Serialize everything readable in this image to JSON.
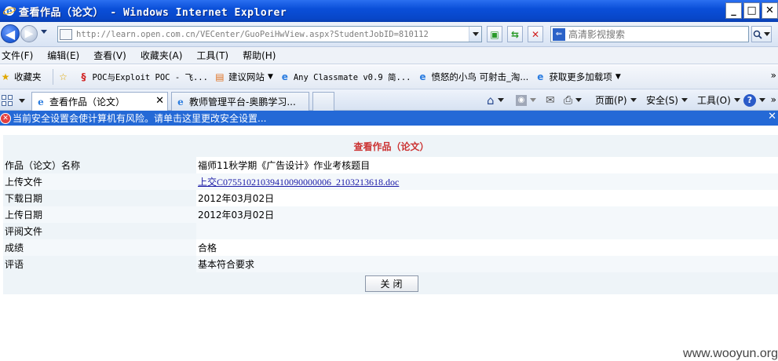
{
  "window": {
    "title": "查看作品（论文） - Windows Internet Explorer",
    "controls": {
      "minimize": "_",
      "maximize": "□",
      "close": "✕"
    }
  },
  "address": {
    "url": "http://learn.open.com.cn/VECenter/GuoPeiHwView.aspx?StudentJobID=810112",
    "search_placeholder": "高清影视搜索"
  },
  "menu": [
    "文件(F)",
    "编辑(E)",
    "查看(V)",
    "收藏夹(A)",
    "工具(T)",
    "帮助(H)"
  ],
  "favorites": {
    "label": "收藏夹",
    "items": [
      "POC与Exploit POC - 飞...",
      "建议网站",
      "Any Classmate v0.9 简...",
      "愤怒的小鸟 可射击_淘...",
      "获取更多加载项"
    ]
  },
  "tabs": [
    {
      "label": "查看作品（论文）",
      "active": true
    },
    {
      "label": "教师管理平台-奥鹏学习...",
      "active": false
    }
  ],
  "commands": {
    "page": "页面(P)",
    "safety": "安全(S)",
    "tools": "工具(O)"
  },
  "infobar": {
    "message": "当前安全设置会使计算机有风险。请单击这里更改安全设置..."
  },
  "form": {
    "heading": "查看作品（论文）",
    "rows": [
      {
        "label": "作品（论文）名称",
        "value": "福师11秋学期《广告设计》作业考核题目",
        "link": false
      },
      {
        "label": "上传文件",
        "value": "上交C07551021039410090000006_2103213618.doc",
        "link": true
      },
      {
        "label": "下载日期",
        "value": "2012年03月02日",
        "link": false
      },
      {
        "label": "上传日期",
        "value": "2012年03月02日",
        "link": false
      },
      {
        "label": "评阅文件",
        "value": "",
        "link": false
      },
      {
        "label": "成绩",
        "value": "合格",
        "link": false
      },
      {
        "label": "评语",
        "value": "基本符合要求",
        "link": false
      }
    ],
    "close_label": "关闭"
  },
  "watermark": "www.wooyun.org"
}
